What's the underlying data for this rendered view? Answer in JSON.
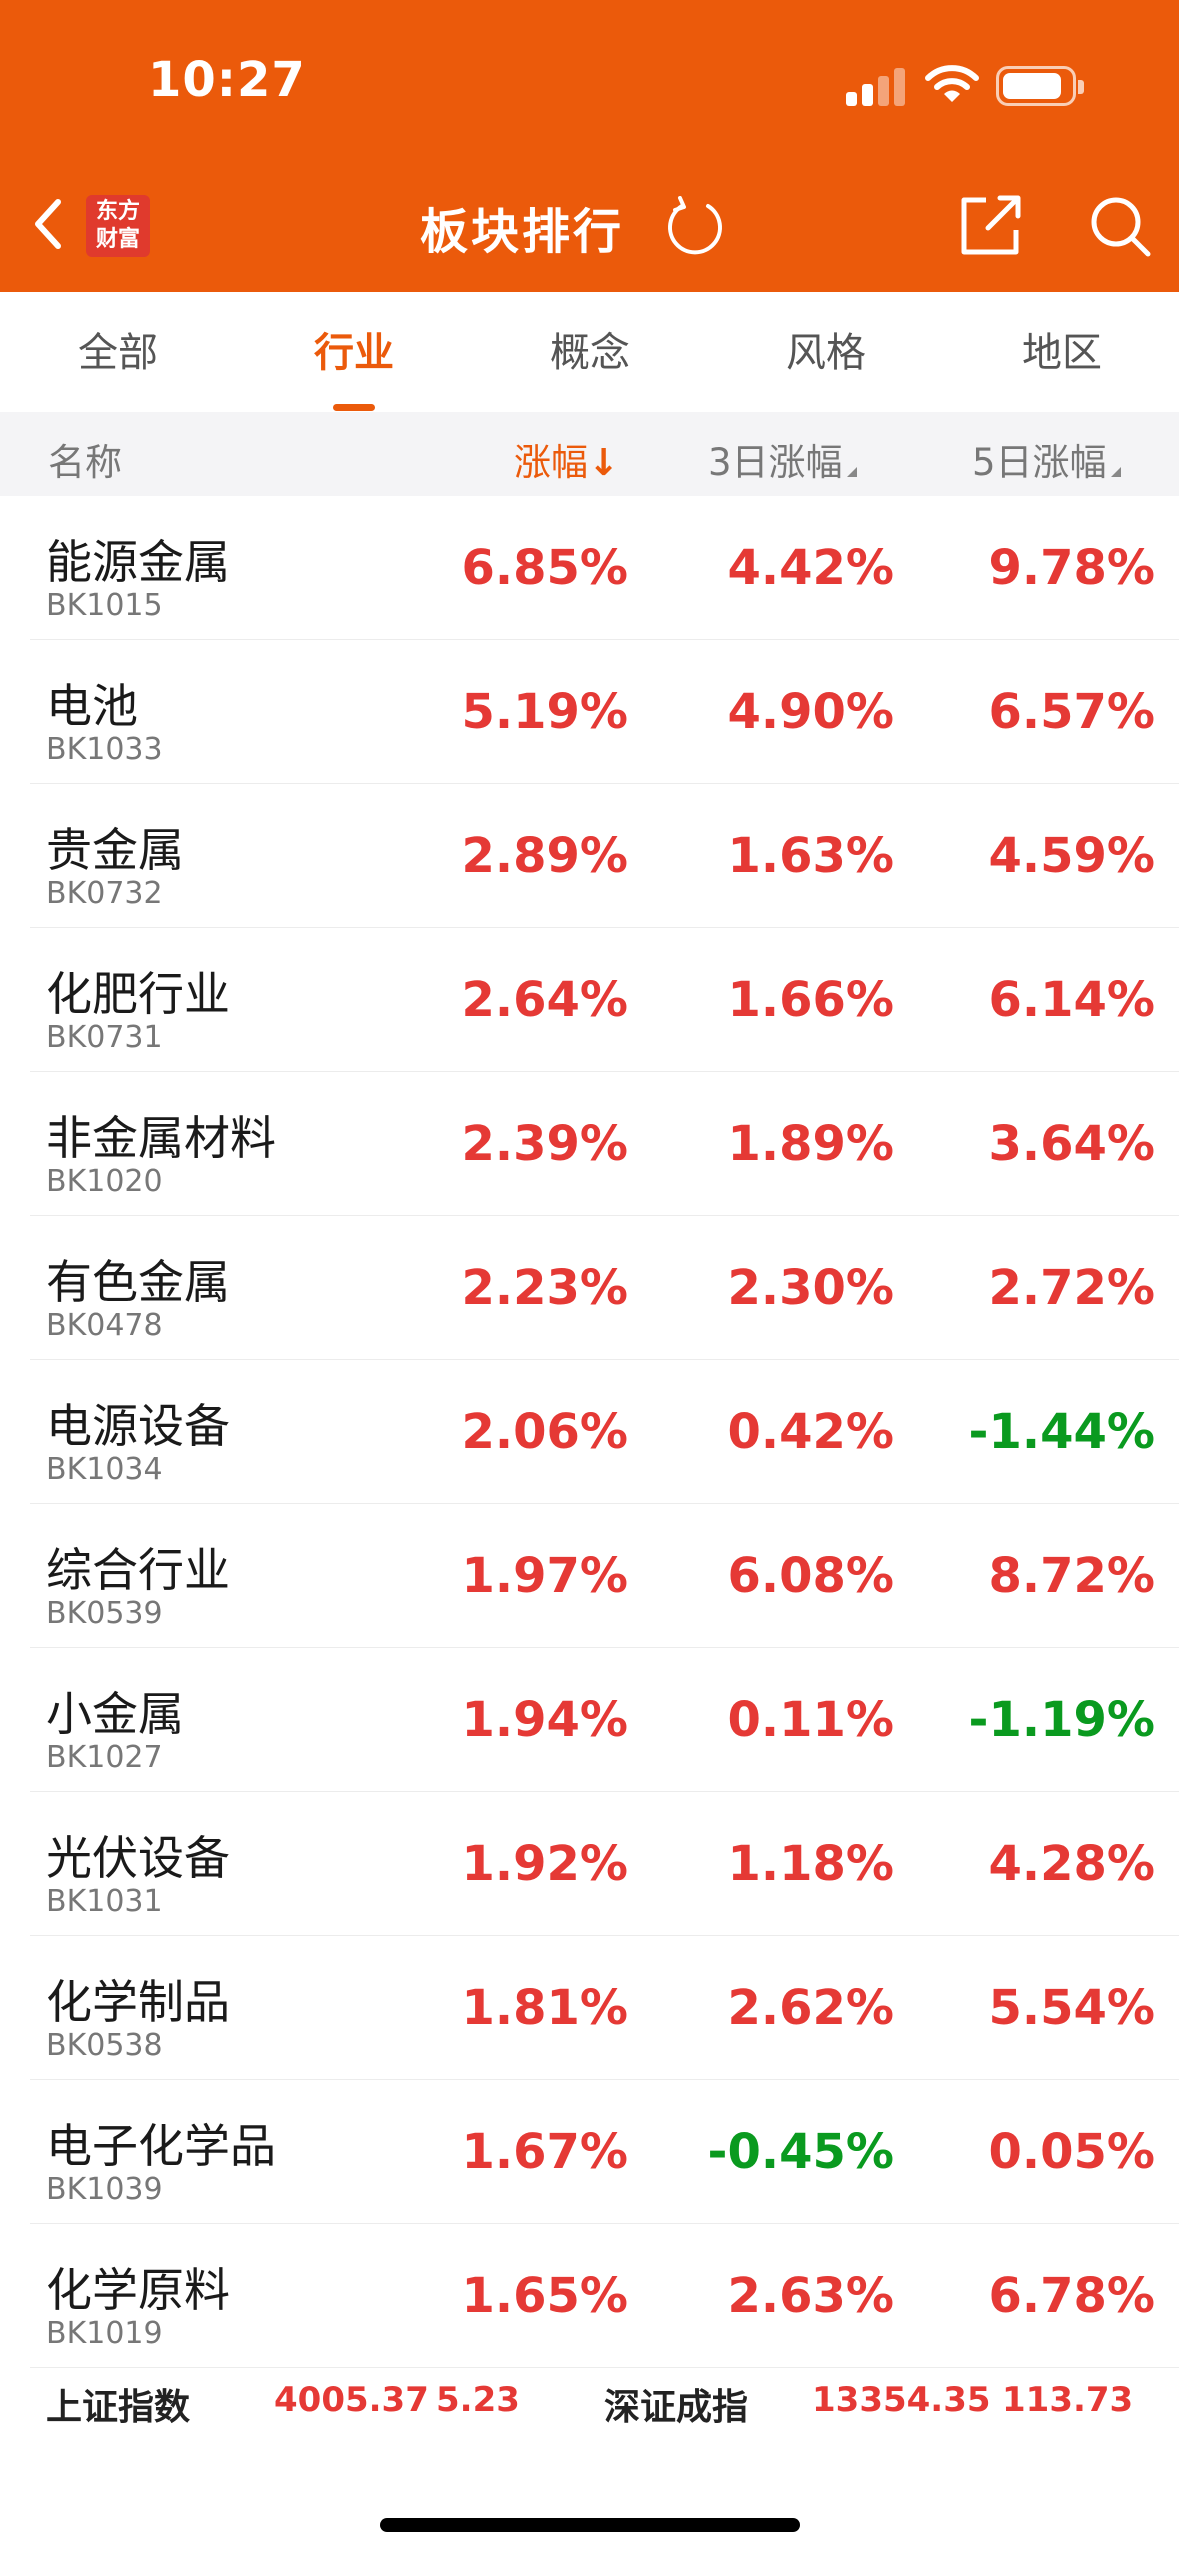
{
  "status_bar": {
    "time": "10:27"
  },
  "header": {
    "logo_line1": "东方",
    "logo_line2": "财富",
    "title": "板块排行"
  },
  "tabs": [
    {
      "label": "全部",
      "active": false
    },
    {
      "label": "行业",
      "active": true
    },
    {
      "label": "概念",
      "active": false
    },
    {
      "label": "风格",
      "active": false
    },
    {
      "label": "地区",
      "active": false
    }
  ],
  "columns": {
    "name": "名称",
    "change": "涨幅",
    "change_sort_arrow": "↓",
    "change_3d": "3日涨幅",
    "change_5d": "5日涨幅"
  },
  "rows": [
    {
      "name": "能源金属",
      "code": "BK1015",
      "change": "6.85%",
      "change_3d": "4.42%",
      "change_5d": "9.78%"
    },
    {
      "name": "电池",
      "code": "BK1033",
      "change": "5.19%",
      "change_3d": "4.90%",
      "change_5d": "6.57%"
    },
    {
      "name": "贵金属",
      "code": "BK0732",
      "change": "2.89%",
      "change_3d": "1.63%",
      "change_5d": "4.59%"
    },
    {
      "name": "化肥行业",
      "code": "BK0731",
      "change": "2.64%",
      "change_3d": "1.66%",
      "change_5d": "6.14%"
    },
    {
      "name": "非金属材料",
      "code": "BK1020",
      "change": "2.39%",
      "change_3d": "1.89%",
      "change_5d": "3.64%"
    },
    {
      "name": "有色金属",
      "code": "BK0478",
      "change": "2.23%",
      "change_3d": "2.30%",
      "change_5d": "2.72%"
    },
    {
      "name": "电源设备",
      "code": "BK1034",
      "change": "2.06%",
      "change_3d": "0.42%",
      "change_5d": "-1.44%"
    },
    {
      "name": "综合行业",
      "code": "BK0539",
      "change": "1.97%",
      "change_3d": "6.08%",
      "change_5d": "8.72%"
    },
    {
      "name": "小金属",
      "code": "BK1027",
      "change": "1.94%",
      "change_3d": "0.11%",
      "change_5d": "-1.19%"
    },
    {
      "name": "光伏设备",
      "code": "BK1031",
      "change": "1.92%",
      "change_3d": "1.18%",
      "change_5d": "4.28%"
    },
    {
      "name": "化学制品",
      "code": "BK0538",
      "change": "1.81%",
      "change_3d": "2.62%",
      "change_5d": "5.54%"
    },
    {
      "name": "电子化学品",
      "code": "BK1039",
      "change": "1.67%",
      "change_3d": "-0.45%",
      "change_5d": "0.05%"
    },
    {
      "name": "化学原料",
      "code": "BK1019",
      "change": "1.65%",
      "change_3d": "2.63%",
      "change_5d": "6.78%"
    }
  ],
  "index_bar": {
    "sh_label": "上证指数",
    "sh_value": "4005.37",
    "sh_change": "5.23",
    "sz_label": "深证成指",
    "sz_value": "13354.35",
    "sz_change": "113.73"
  },
  "colors": {
    "brand": "#EB5A0B",
    "up": "#E53935",
    "down": "#0A9A1F"
  },
  "icons": [
    "back-icon",
    "refresh-icon",
    "share-icon",
    "search-icon",
    "signal-icon",
    "wifi-icon",
    "battery-icon"
  ]
}
